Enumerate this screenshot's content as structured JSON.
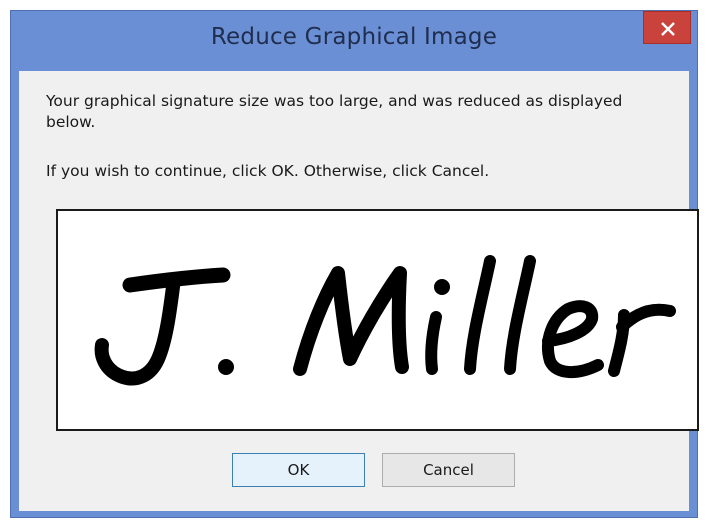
{
  "window": {
    "title": "Reduce Graphical Image"
  },
  "message": {
    "line1": "Your graphical signature size was too large, and was reduced as displayed below.",
    "line2": "If you wish to continue, click OK. Otherwise, click Cancel."
  },
  "signature": {
    "text": "J. Miller"
  },
  "buttons": {
    "ok_label": "OK",
    "cancel_label": "Cancel"
  },
  "colors": {
    "titlebar": "#6b8fd4",
    "close": "#c9423b",
    "client": "#f0f0f0"
  }
}
